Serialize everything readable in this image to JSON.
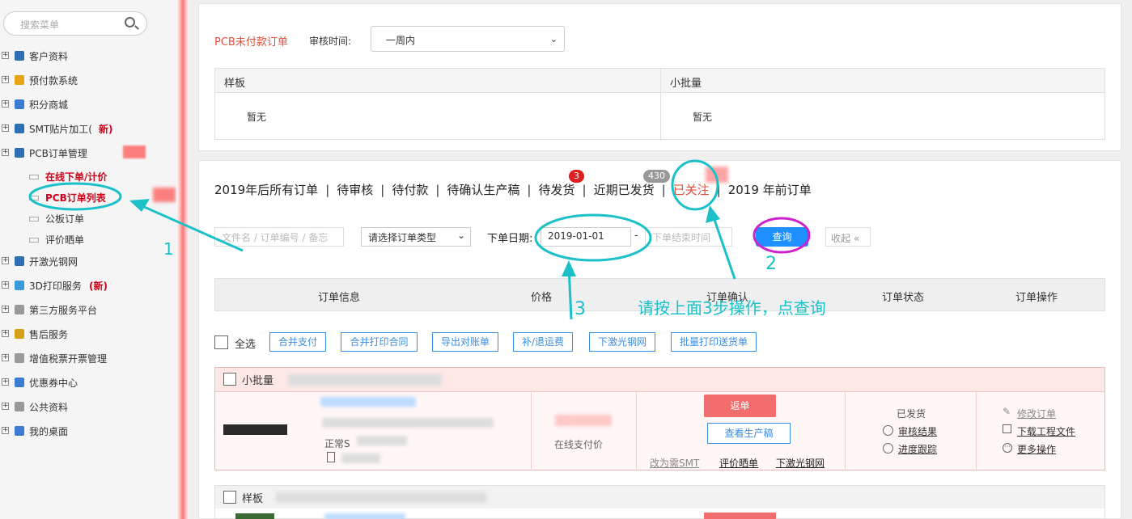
{
  "sidebar": {
    "search_placeholder": "搜索菜单",
    "items": [
      {
        "label": "客户资料",
        "color": "#2b6fb5"
      },
      {
        "label": "预付款系统",
        "color": "#e8a316"
      },
      {
        "label": "积分商城",
        "color": "#3b7cd5"
      },
      {
        "label": "SMT贴片加工(",
        "extra": "新)",
        "color": "#2b6fb5"
      },
      {
        "label": "PCB订单管理",
        "color": "#2b6fb5"
      },
      {
        "label": "开激光钢网",
        "color": "#2b6fb5"
      },
      {
        "label": "3D打印服务",
        "extra": "(新)",
        "color": "#3b9ad9"
      },
      {
        "label": "第三方服务平台",
        "color": "#999"
      },
      {
        "label": "售后服务",
        "color": "#d4a017"
      },
      {
        "label": "增值税票开票管理",
        "color": "#999"
      },
      {
        "label": "优惠券中心",
        "color": "#3b7cd5"
      },
      {
        "label": "公共资料",
        "color": "#999"
      },
      {
        "label": "我的桌面",
        "color": "#3b7cd5"
      }
    ],
    "subs": [
      "在线下单/计价",
      "PCB订单列表",
      "公板订单",
      "评价晒单"
    ]
  },
  "top": {
    "title": "PCB未付款订单",
    "audit_label": "审核时间:",
    "audit_value": "一周内",
    "col1": "样板",
    "col2": "小批量",
    "none1": "暂无",
    "none2": "暂无"
  },
  "tabs": [
    "2019年后所有订单",
    "待审核",
    "待付款",
    "待确认生产稿",
    "待发货",
    "近期已发货",
    "已关注",
    "2019 年前订单"
  ],
  "badges": {
    "pending_ship": "3",
    "recent": "430"
  },
  "filters": {
    "keyword_placeholder": "文件名 / 订单编号 / 备忘",
    "type_value": "请选择订单类型",
    "date_label": "下单日期:",
    "date_start": "2019-01-01",
    "dash": "-",
    "date_end_placeholder": "下单结束时间",
    "query": "查询",
    "collapse": "收起"
  },
  "table_headers": [
    "订单信息",
    "价格",
    "订单确认",
    "订单状态",
    "订单操作"
  ],
  "actions": {
    "select_all": "全选",
    "buttons": [
      "合并支付",
      "合并打印合同",
      "导出对账单",
      "补/退运费",
      "下激光钢网",
      "批量打印送货单"
    ]
  },
  "order1": {
    "type": "小批量",
    "status_text": "正常S",
    "pay": "在线支付价",
    "return_btn": "返单",
    "view_btn": "查看生产稿",
    "links": [
      "改为需SMT",
      "评价晒单",
      "下激光钢网"
    ],
    "state": "已发货",
    "audit": "审核结果",
    "progress": "进度跟踪",
    "ops": [
      "修改订单",
      "下载工程文件",
      "更多操作"
    ]
  },
  "order2": {
    "type": "样板"
  },
  "annotations": {
    "n1": "1",
    "n2": "2",
    "n3": "3",
    "hint": "请按上面3步操作，点查询"
  }
}
